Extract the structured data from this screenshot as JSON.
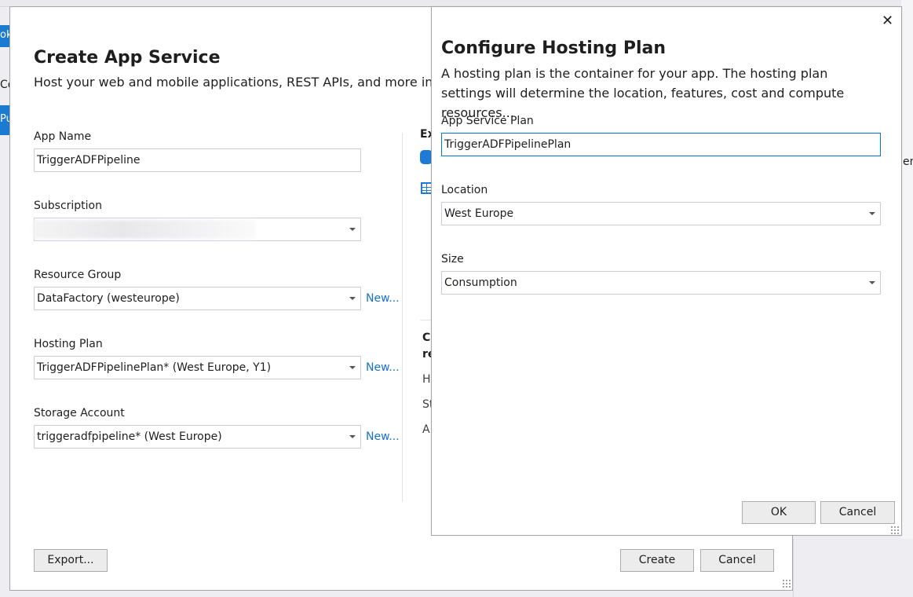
{
  "background": {
    "left_edge_texts": [
      "oke",
      "Co",
      "Pu"
    ],
    "right_edge_text": "ent"
  },
  "create_dialog": {
    "title": "Create App Service",
    "subtitle": "Host your web and mobile applications, REST APIs, and more in",
    "app_name": {
      "label": "App Name",
      "value": "TriggerADFPipeline"
    },
    "subscription": {
      "label": "Subscription",
      "value": ""
    },
    "resource_group": {
      "label": "Resource Group",
      "value": "DataFactory (westeurope)",
      "new_link": "New..."
    },
    "hosting_plan": {
      "label": "Hosting Plan",
      "value": "TriggerADFPipelinePlan* (West Europe, Y1)",
      "new_link": "New..."
    },
    "storage_account": {
      "label": "Storage Account",
      "value": "triggeradfpipeline* (West Europe)",
      "new_link": "New..."
    },
    "right_column": {
      "heading_top": "Ex",
      "heading_mid_1": "Cl",
      "heading_mid_2": "re",
      "items": [
        "H",
        "St",
        "A"
      ]
    },
    "buttons": {
      "export": "Export...",
      "create": "Create",
      "cancel": "Cancel"
    }
  },
  "hosting_dialog": {
    "title": "Configure Hosting Plan",
    "description": "A hosting plan is the container for your app. The hosting plan settings will determine the location, features, cost and compute resources...",
    "plan": {
      "label": "App Service Plan",
      "value": "TriggerADFPipelinePlan"
    },
    "location": {
      "label": "Location",
      "value": "West Europe"
    },
    "size": {
      "label": "Size",
      "value": "Consumption"
    },
    "buttons": {
      "ok": "OK",
      "cancel": "Cancel"
    },
    "close_glyph": "✕"
  },
  "colors": {
    "accent": "#007acc",
    "link": "#1a73c7",
    "left_bar": "#1a7bd1"
  }
}
